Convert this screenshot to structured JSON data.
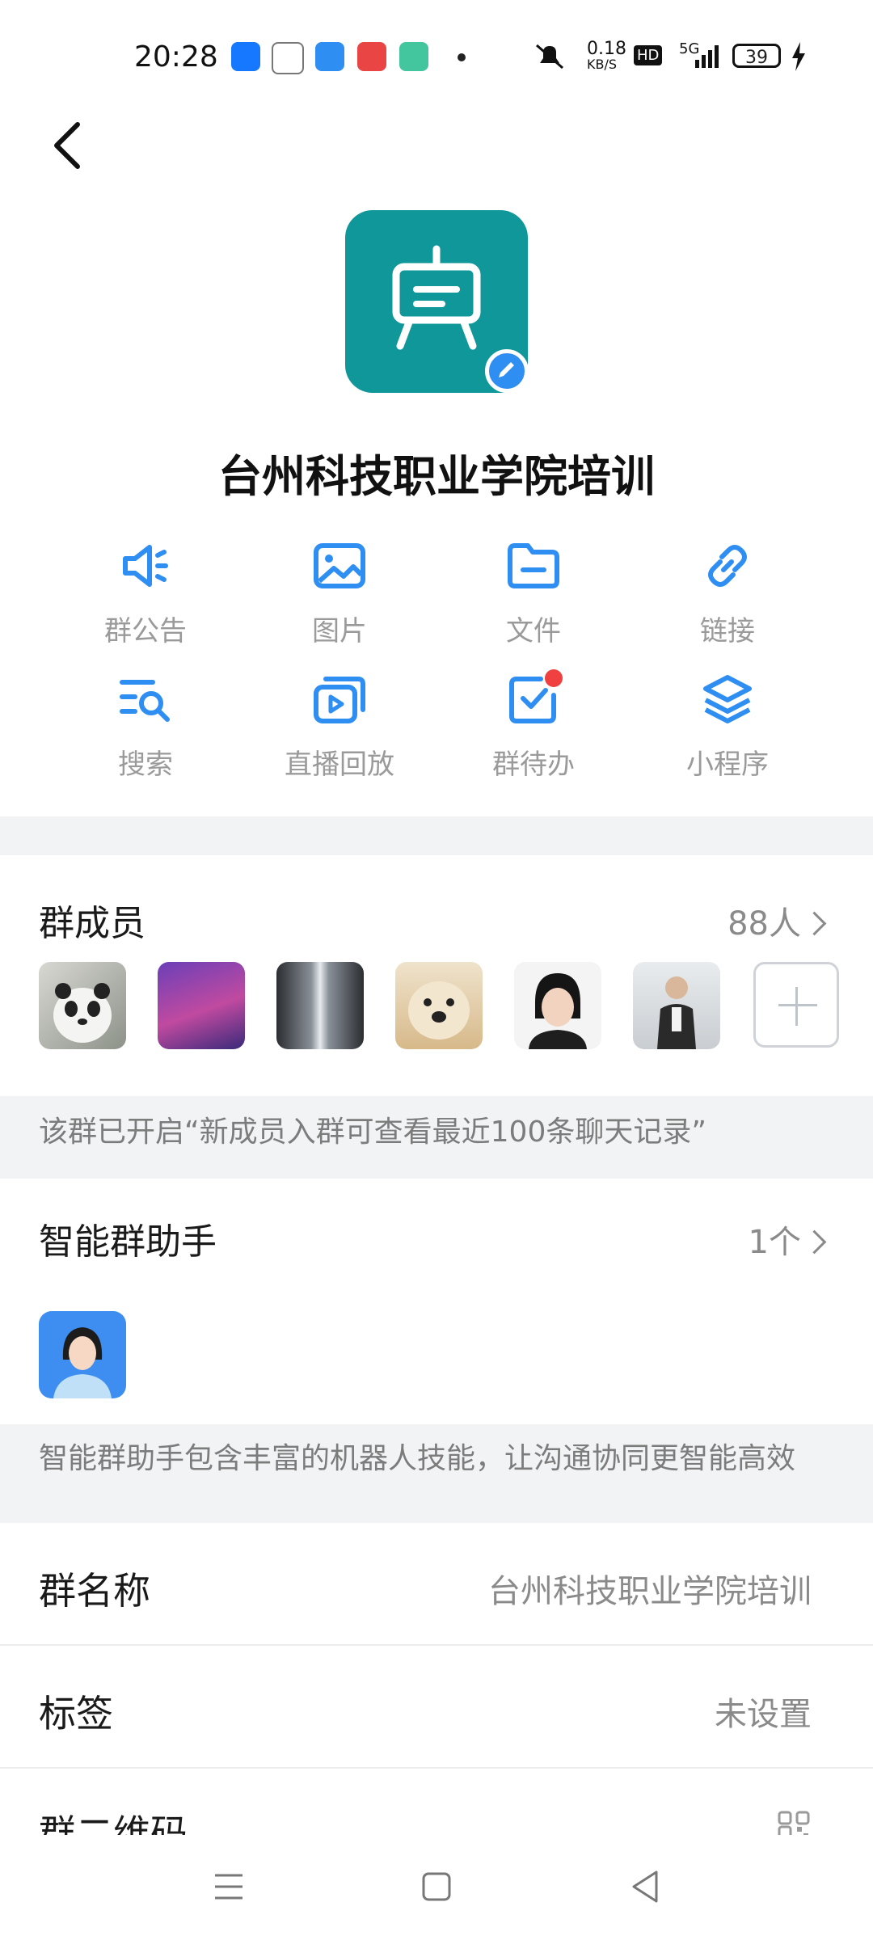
{
  "status_bar": {
    "time": "20:28",
    "net_speed_value": "0.18",
    "net_speed_unit": "KB/S",
    "hd_badge": "HD",
    "network": "5G",
    "battery": "39"
  },
  "header": {
    "group_name": "台州科技职业学院培训"
  },
  "features": [
    {
      "label": "群公告",
      "icon": "announcement-icon"
    },
    {
      "label": "图片",
      "icon": "image-icon"
    },
    {
      "label": "文件",
      "icon": "folder-icon"
    },
    {
      "label": "链接",
      "icon": "link-icon"
    },
    {
      "label": "搜索",
      "icon": "search-icon"
    },
    {
      "label": "直播回放",
      "icon": "live-replay-icon"
    },
    {
      "label": "群待办",
      "icon": "todo-icon"
    },
    {
      "label": "小程序",
      "icon": "mini-program-icon"
    }
  ],
  "members": {
    "title": "群成员",
    "count": "88人",
    "note": "该群已开启“新成员入群可查看最近100条聊天记录”"
  },
  "assistant": {
    "title": "智能群助手",
    "count": "1个",
    "note": "智能群助手包含丰富的机器人技能，让沟通协同更智能高效"
  },
  "settings": {
    "group_name_label": "群名称",
    "group_name_value": "台州科技职业学院培训",
    "tag_label": "标签",
    "tag_value": "未设置",
    "qr_label": "群二维码"
  },
  "colors": {
    "accent": "#2f8ef2",
    "group_avatar": "#10979a",
    "divider": "#f2f3f5"
  }
}
